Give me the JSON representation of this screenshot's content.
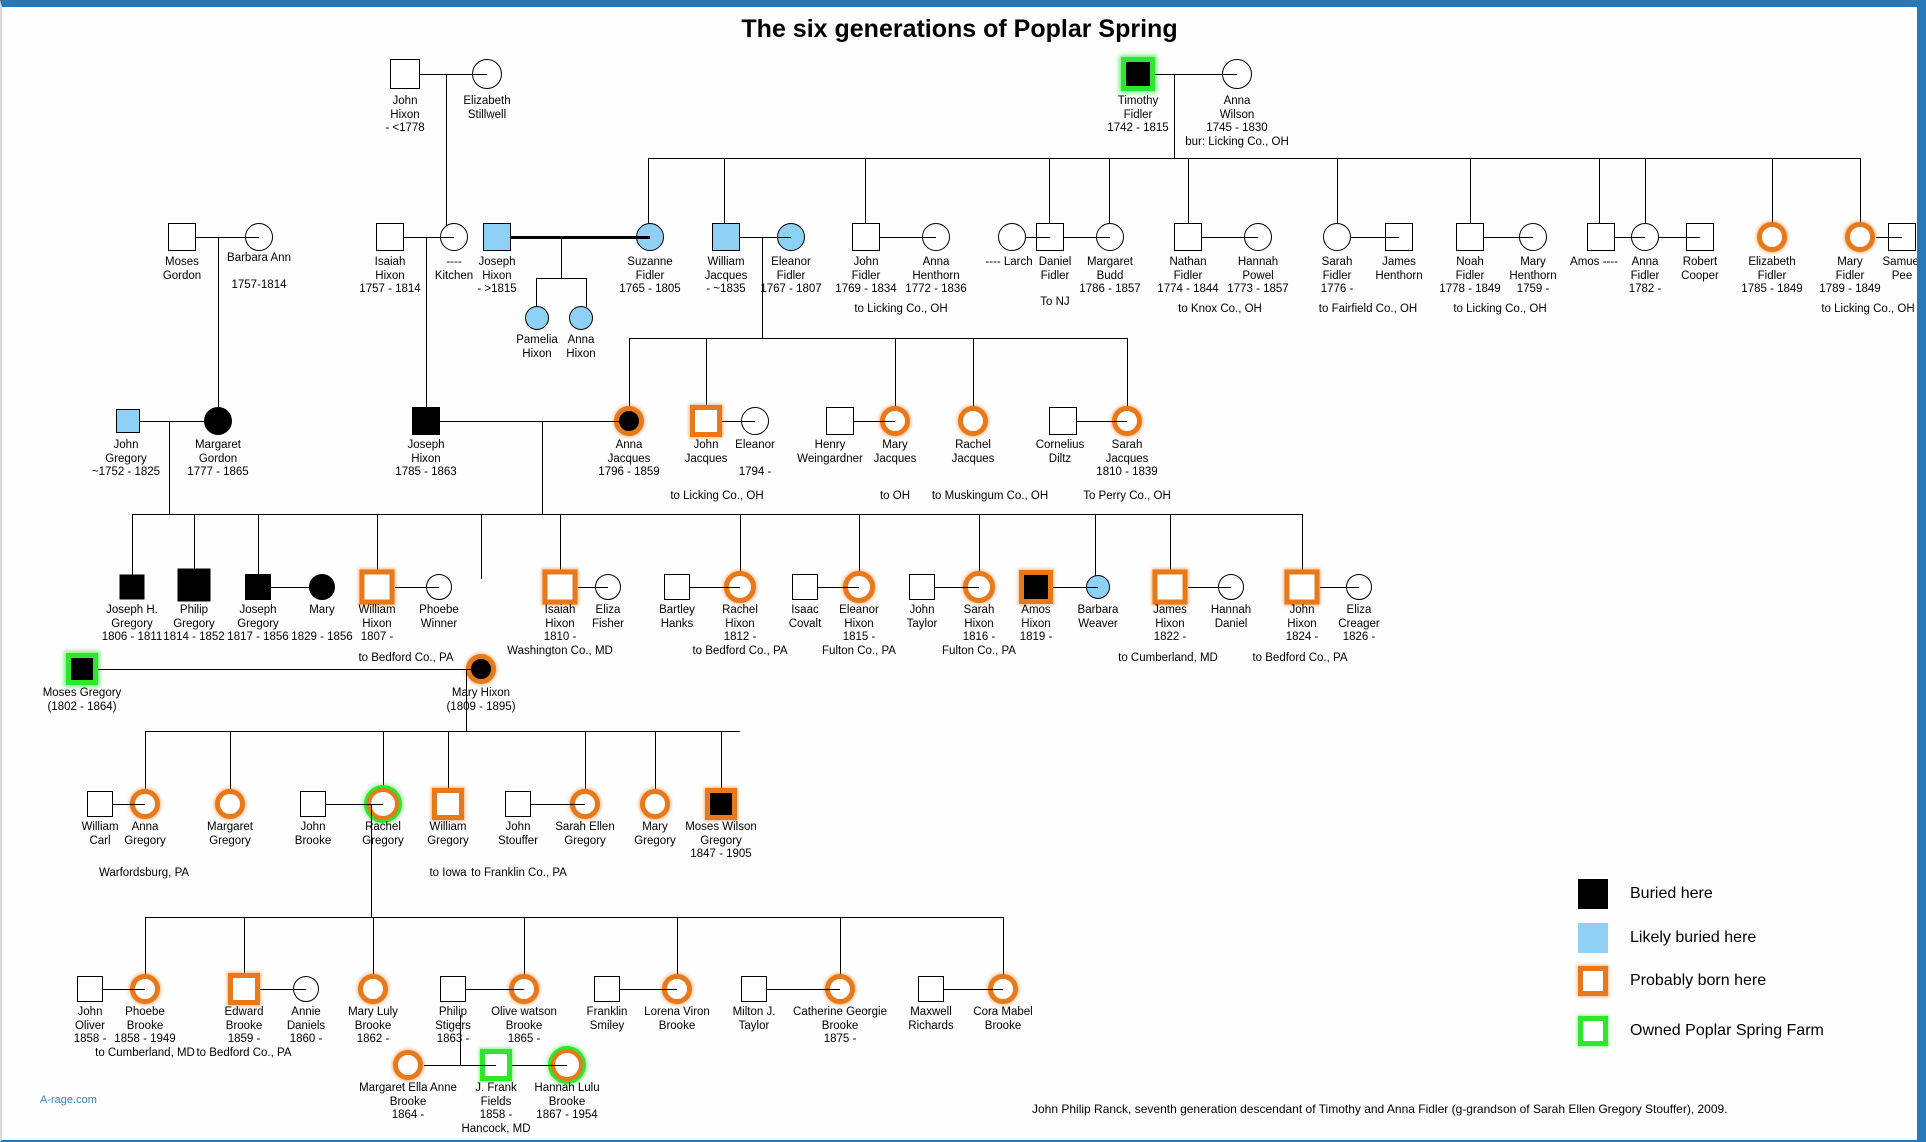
{
  "title": "The six generations of Poplar Spring",
  "brand": "A-rage.com",
  "footer": "John Philip Ranck, seventh generation descendant of Timothy and Anna Fidler (g-grandson of Sarah Ellen Gregory Stouffer), 2009.",
  "colors": {
    "buried": "#000000",
    "likely_buried": "#8fd0f5",
    "probably_born": "#e8791a",
    "owned_farm": "#2ee62e",
    "border": "#2878b8",
    "brand_text": "#3a7fc0"
  },
  "legend": {
    "items": [
      {
        "label": "Buried here",
        "style": "black",
        "shape": "square"
      },
      {
        "label": "Likely buried here",
        "style": "blue",
        "shape": "square"
      },
      {
        "label": "Probably born here",
        "style": "orange",
        "shape": "square"
      },
      {
        "label": "Owned Poplar Spring Farm",
        "style": "green",
        "shape": "square"
      }
    ]
  },
  "people": {
    "john_hixon": {
      "name1": "John",
      "name2": "Hixon",
      "dates": "- <1778",
      "extra": ""
    },
    "elizabeth_stillwell": {
      "name1": "Elizabeth",
      "name2": "Stillwell",
      "dates": "",
      "extra": ""
    },
    "timothy_fidler": {
      "name1": "Timothy",
      "name2": "Fidler",
      "dates": "1742 - 1815",
      "extra": ""
    },
    "anna_wilson": {
      "name1": "Anna",
      "name2": "Wilson",
      "dates": "1745 - 1830",
      "extra": "bur: Licking Co., OH"
    },
    "moses_gordon": {
      "name1": "Moses",
      "name2": "Gordon",
      "dates": "",
      "extra": ""
    },
    "barbara_ann": {
      "name1": "Barbara Ann",
      "name2": "",
      "dates": "1757-1814",
      "extra": ""
    },
    "isaiah_hixon": {
      "name1": "Isaiah",
      "name2": "Hixon",
      "dates": "1757 - 1814",
      "extra": ""
    },
    "kitchen": {
      "name1": "----",
      "name2": "Kitchen",
      "dates": "",
      "extra": ""
    },
    "joseph_hixon_sr": {
      "name1": "Joseph",
      "name2": "Hixon",
      "dates": "- >1815",
      "extra": ""
    },
    "suzanne_fidler": {
      "name1": "Suzanne",
      "name2": "Fidler",
      "dates": "1765 - 1805",
      "extra": ""
    },
    "william_jacques": {
      "name1": "William",
      "name2": "Jacques",
      "dates": "- ~1835",
      "extra": ""
    },
    "eleanor_fidler": {
      "name1": "Eleanor",
      "name2": "Fidler",
      "dates": "1767 - 1807",
      "extra": ""
    },
    "john_fidler": {
      "name1": "John",
      "name2": "Fidler",
      "dates": "1769 - 1834",
      "extra": "to Licking Co., OH"
    },
    "anna_henthorn": {
      "name1": "Anna",
      "name2": "Henthorn",
      "dates": "1772 - 1836",
      "extra": ""
    },
    "larch": {
      "name1": "---- Larch",
      "name2": "",
      "dates": "",
      "extra": ""
    },
    "daniel_fidler": {
      "name1": "Daniel",
      "name2": "Fidler",
      "dates": "",
      "extra": "To NJ"
    },
    "margaret_budd": {
      "name1": "Margaret",
      "name2": "Budd",
      "dates": "1786 - 1857",
      "extra": ""
    },
    "nathan_fidler": {
      "name1": "Nathan",
      "name2": "Fidler",
      "dates": "1774 - 1844",
      "extra": "to Knox Co., OH"
    },
    "hannah_powel": {
      "name1": "Hannah",
      "name2": "Powel",
      "dates": "1773 - 1857",
      "extra": ""
    },
    "sarah_fidler": {
      "name1": "Sarah",
      "name2": "Fidler",
      "dates": "1776 -",
      "extra": "to Fairfield Co., OH"
    },
    "james_henthorn": {
      "name1": "James",
      "name2": "Henthorn",
      "dates": "",
      "extra": ""
    },
    "noah_fidler": {
      "name1": "Noah",
      "name2": "Fidler",
      "dates": "1778 - 1849",
      "extra": "to Licking Co., OH"
    },
    "mary_henthorn": {
      "name1": "Mary",
      "name2": "Henthorn",
      "dates": "1759 -",
      "extra": ""
    },
    "amos_blank": {
      "name1": "Amos ----",
      "name2": "",
      "dates": "",
      "extra": ""
    },
    "anna_fidler": {
      "name1": "Anna",
      "name2": "Fidler",
      "dates": "1782 -",
      "extra": ""
    },
    "robert_cooper": {
      "name1": "Robert",
      "name2": "Cooper",
      "dates": "",
      "extra": ""
    },
    "elizabeth_fidler": {
      "name1": "Elizabeth",
      "name2": "Fidler",
      "dates": "1785 - 1849",
      "extra": ""
    },
    "mary_fidler": {
      "name1": "Mary",
      "name2": "Fidler",
      "dates": "1789 - 1849",
      "extra": "to Licking Co., OH"
    },
    "samuel_pee": {
      "name1": "Samuel",
      "name2": "Pee",
      "dates": "",
      "extra": ""
    },
    "pamelia_hixon": {
      "name1": "Pamelia",
      "name2": "Hixon",
      "dates": "",
      "extra": ""
    },
    "anna_hixon": {
      "name1": "Anna",
      "name2": "Hixon",
      "dates": "",
      "extra": ""
    },
    "john_gregory": {
      "name1": "John",
      "name2": "Gregory",
      "dates": "~1752 - 1825",
      "extra": ""
    },
    "margaret_gordon": {
      "name1": "Margaret",
      "name2": "Gordon",
      "dates": "1777 - 1865",
      "extra": ""
    },
    "joseph_hixon": {
      "name1": "Joseph",
      "name2": "Hixon",
      "dates": "1785 - 1863",
      "extra": ""
    },
    "anna_jacques": {
      "name1": "Anna",
      "name2": "Jacques",
      "dates": "1796 - 1859",
      "extra": ""
    },
    "john_jacques": {
      "name1": "John",
      "name2": "Jacques",
      "dates": "",
      "extra": "to Licking Co., OH"
    },
    "eleanor_jacques_w": {
      "name1": "Eleanor",
      "name2": "",
      "dates": "1794 -",
      "extra": ""
    },
    "henry_weingardner": {
      "name1": "Henry",
      "name2": "Weingardner",
      "dates": "",
      "extra": ""
    },
    "mary_jacques": {
      "name1": "Mary",
      "name2": "Jacques",
      "dates": "",
      "extra": "to OH"
    },
    "rachel_jacques": {
      "name1": "Rachel",
      "name2": "Jacques",
      "dates": "",
      "extra": "to Muskingum Co., OH"
    },
    "cornelius_diltz": {
      "name1": "Cornelius",
      "name2": "Diltz",
      "dates": "",
      "extra": ""
    },
    "sarah_jacques": {
      "name1": "Sarah",
      "name2": "Jacques",
      "dates": "1810 - 1839",
      "extra": "To Perry Co., OH"
    },
    "joseph_h_gregory": {
      "name1": "Joseph H.",
      "name2": "Gregory",
      "dates": "1806 - 1811",
      "extra": ""
    },
    "philip_gregory": {
      "name1": "Philip",
      "name2": "Gregory",
      "dates": "1814 - 1852",
      "extra": ""
    },
    "joseph_gregory": {
      "name1": "Joseph",
      "name2": "Gregory",
      "dates": "1817 - 1856",
      "extra": ""
    },
    "mary_g": {
      "name1": "Mary",
      "name2": "",
      "dates": "1829 - 1856",
      "extra": ""
    },
    "william_hixon": {
      "name1": "William",
      "name2": "Hixon",
      "dates": "1807 -",
      "extra": "to Bedford Co., PA"
    },
    "phoebe_winner": {
      "name1": "Phoebe",
      "name2": "Winner",
      "dates": "",
      "extra": ""
    },
    "isaiah_hixon_2": {
      "name1": "Isaiah",
      "name2": "Hixon",
      "dates": "1810 -",
      "extra": "Washington Co., MD"
    },
    "eliza_fisher": {
      "name1": "Eliza",
      "name2": "Fisher",
      "dates": "",
      "extra": ""
    },
    "bartley_hanks": {
      "name1": "Bartley",
      "name2": "Hanks",
      "dates": "",
      "extra": ""
    },
    "rachel_hixon": {
      "name1": "Rachel",
      "name2": "Hixon",
      "dates": "1812 -",
      "extra": "to Bedford Co., PA"
    },
    "isaac_covalt": {
      "name1": "Isaac",
      "name2": "Covalt",
      "dates": "",
      "extra": ""
    },
    "eleanor_hixon": {
      "name1": "Eleanor",
      "name2": "Hixon",
      "dates": "1815 -",
      "extra": "Fulton Co., PA"
    },
    "john_taylor": {
      "name1": "John",
      "name2": "Taylor",
      "dates": "",
      "extra": ""
    },
    "sarah_hixon": {
      "name1": "Sarah",
      "name2": "Hixon",
      "dates": "1816 -",
      "extra": "Fulton Co., PA"
    },
    "amos_hixon": {
      "name1": "Amos",
      "name2": "Hixon",
      "dates": "1819 -",
      "extra": ""
    },
    "barbara_weaver": {
      "name1": "Barbara",
      "name2": "Weaver",
      "dates": "",
      "extra": ""
    },
    "james_hixon": {
      "name1": "James",
      "name2": "Hixon",
      "dates": "1822 -",
      "extra": "to Cumberland, MD"
    },
    "hannah_daniel": {
      "name1": "Hannah",
      "name2": "Daniel",
      "dates": "",
      "extra": ""
    },
    "john_hixon_2": {
      "name1": "John",
      "name2": "Hixon",
      "dates": "1824 -",
      "extra": "to Bedford Co., PA"
    },
    "eliza_creager": {
      "name1": "Eliza",
      "name2": "Creager",
      "dates": "1826 -",
      "extra": ""
    },
    "moses_gregory": {
      "name1": "Moses Gregory",
      "name2": "(1802 - 1864)",
      "dates": "",
      "extra": ""
    },
    "mary_hixon": {
      "name1": "Mary Hixon",
      "name2": "(1809 - 1895)",
      "dates": "",
      "extra": ""
    },
    "william_carl": {
      "name1": "William",
      "name2": "Carl",
      "dates": "",
      "extra": ""
    },
    "anna_gregory": {
      "name1": "Anna",
      "name2": "Gregory",
      "dates": "",
      "extra": "Warfordsburg, PA"
    },
    "margaret_gregory": {
      "name1": "Margaret",
      "name2": "Gregory",
      "dates": "",
      "extra": ""
    },
    "john_brooke": {
      "name1": "John",
      "name2": "Brooke",
      "dates": "",
      "extra": ""
    },
    "rachel_gregory": {
      "name1": "Rachel",
      "name2": "Gregory",
      "dates": "",
      "extra": ""
    },
    "william_gregory": {
      "name1": "William",
      "name2": "Gregory",
      "dates": "",
      "extra": "to Iowa"
    },
    "john_stouffer": {
      "name1": "John",
      "name2": "Stouffer",
      "dates": "",
      "extra": ""
    },
    "sarah_ellen_gregory": {
      "name1": "Sarah Ellen",
      "name2": "Gregory",
      "dates": "",
      "extra": "to Franklin Co., PA"
    },
    "mary_gregory": {
      "name1": "Mary",
      "name2": "Gregory",
      "dates": "",
      "extra": ""
    },
    "moses_wilson_gregory": {
      "name1": "Moses Wilson",
      "name2": "Gregory",
      "dates": "1847 - 1905",
      "extra": ""
    },
    "john_oliver": {
      "name1": "John",
      "name2": "Oliver",
      "dates": "1858 -",
      "extra": ""
    },
    "phoebe_brooke": {
      "name1": "Phoebe",
      "name2": "Brooke",
      "dates": "1858 - 1949",
      "extra": "to Cumberland, MD"
    },
    "edward_brooke": {
      "name1": "Edward",
      "name2": "Brooke",
      "dates": "1859 -",
      "extra": "to Bedford Co., PA"
    },
    "annie_daniels": {
      "name1": "Annie",
      "name2": "Daniels",
      "dates": "1860 -",
      "extra": ""
    },
    "mary_luly_brooke": {
      "name1": "Mary Luly",
      "name2": "Brooke",
      "dates": "1862 -",
      "extra": ""
    },
    "philip_stigers": {
      "name1": "Philip",
      "name2": "Stigers",
      "dates": "1863 -",
      "extra": ""
    },
    "olive_watson_brooke": {
      "name1": "Olive watson",
      "name2": "Brooke",
      "dates": "1865 -",
      "extra": ""
    },
    "franklin_smiley": {
      "name1": "Franklin",
      "name2": "Smiley",
      "dates": "",
      "extra": ""
    },
    "lorena_viron_brooke": {
      "name1": "Lorena Viron",
      "name2": "Brooke",
      "dates": "",
      "extra": ""
    },
    "milton_j_taylor": {
      "name1": "Milton J.",
      "name2": "Taylor",
      "dates": "",
      "extra": ""
    },
    "catherine_georgie_brooke": {
      "name1": "Catherine Georgie",
      "name2": "Brooke",
      "dates": "1875 -",
      "extra": ""
    },
    "maxwell_richards": {
      "name1": "Maxwell",
      "name2": "Richards",
      "dates": "",
      "extra": ""
    },
    "cora_mabel_brooke": {
      "name1": "Cora Mabel",
      "name2": "Brooke",
      "dates": "",
      "extra": ""
    },
    "margaret_ella_anne_brooke": {
      "name1": "Margaret Ella Anne",
      "name2": "Brooke",
      "dates": "1864 -",
      "extra": ""
    },
    "j_frank_fields": {
      "name1": "J. Frank",
      "name2": "Fields",
      "dates": "1858 -",
      "extra": "Hancock, MD"
    },
    "hannah_lulu_brooke": {
      "name1": "Hannah Lulu",
      "name2": "Brooke",
      "dates": "1867 - 1954",
      "extra": ""
    }
  }
}
